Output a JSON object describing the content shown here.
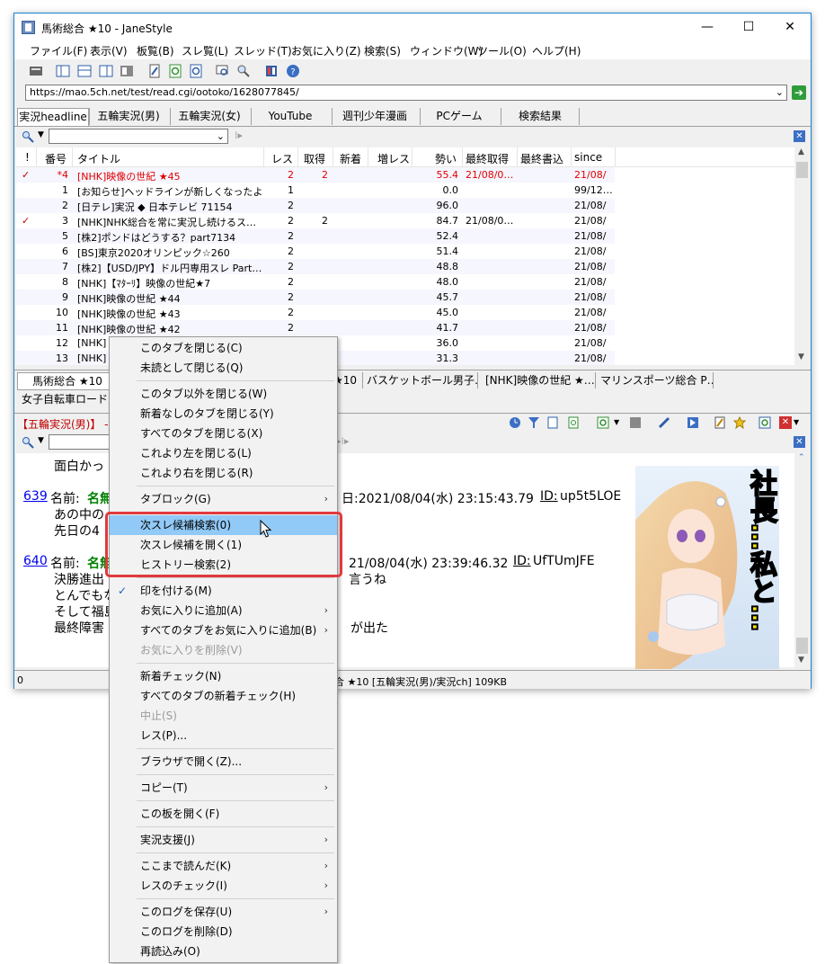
{
  "window": {
    "title": "馬術総合 ★10 - JaneStyle",
    "controls": {
      "minimize": "—",
      "maximize": "☐",
      "close": "✕"
    }
  },
  "menu": [
    "ファイル(F)",
    "表示(V)",
    "板覧(B)",
    "スレ覧(L)",
    "スレッド(T)",
    "お気に入り(Z)",
    "検索(S)",
    "ウィンドウ(W)",
    "ツール(O)",
    "ヘルプ(H)"
  ],
  "address": {
    "url": "https://mao.5ch.net/test/read.cgi/ootoko/1628077845/",
    "go": "➔"
  },
  "board_tabs": [
    "実況headline",
    "五輪実況(男)",
    "五輪実況(女)",
    "YouTube",
    "週刊少年漫画",
    "PCゲーム",
    "検索結果"
  ],
  "thread_list": {
    "columns": [
      "!",
      "番号",
      "タイトル",
      "レス",
      "取得",
      "新着",
      "増レス",
      "勢い",
      "最終取得",
      "最終書込",
      "since"
    ],
    "rows": [
      {
        "mark": "✓",
        "num": "*4",
        "title": "[NHK]映像の世紀 ★45",
        "res": "2",
        "got": "2",
        "ikioi": "55.4",
        "last_get": "21/08/0…",
        "since": "21/08/",
        "red": true
      },
      {
        "mark": "",
        "num": "1",
        "title": "[お知らせ]ヘッドラインが新しくなったよ",
        "res": "1",
        "got": "",
        "ikioi": "0.0",
        "last_get": "",
        "since": "99/12…",
        "red": false
      },
      {
        "mark": "",
        "num": "2",
        "title": "[日テレ]実況 ◆ 日本テレビ 71154",
        "res": "2",
        "got": "",
        "ikioi": "96.0",
        "last_get": "",
        "since": "21/08/",
        "red": false
      },
      {
        "mark": "✓",
        "num": "3",
        "title": "[NHK]NHK総合を常に実況し続けるス…",
        "res": "2",
        "got": "2",
        "ikioi": "84.7",
        "last_get": "21/08/0…",
        "since": "21/08/",
        "red": false
      },
      {
        "mark": "",
        "num": "5",
        "title": "[株2]ポンドはどうする？part7134",
        "res": "2",
        "got": "",
        "ikioi": "52.4",
        "last_get": "",
        "since": "21/08/",
        "red": false
      },
      {
        "mark": "",
        "num": "6",
        "title": "[BS]東京2020オリンピック☆260",
        "res": "2",
        "got": "",
        "ikioi": "51.4",
        "last_get": "",
        "since": "21/08/",
        "red": false
      },
      {
        "mark": "",
        "num": "7",
        "title": "[株2]【USD/JPY】ドル円専用スレ Part…",
        "res": "2",
        "got": "",
        "ikioi": "48.8",
        "last_get": "",
        "since": "21/08/",
        "red": false
      },
      {
        "mark": "",
        "num": "8",
        "title": "[NHK]【ﾏﾀｰﾘ】映像の世紀★7",
        "res": "2",
        "got": "",
        "ikioi": "48.0",
        "last_get": "",
        "since": "21/08/",
        "red": false
      },
      {
        "mark": "",
        "num": "9",
        "title": "[NHK]映像の世紀 ★44",
        "res": "2",
        "got": "",
        "ikioi": "45.7",
        "last_get": "",
        "since": "21/08/",
        "red": false
      },
      {
        "mark": "",
        "num": "10",
        "title": "[NHK]映像の世紀 ★43",
        "res": "2",
        "got": "",
        "ikioi": "45.0",
        "last_get": "",
        "since": "21/08/",
        "red": false
      },
      {
        "mark": "",
        "num": "11",
        "title": "[NHK]映像の世紀 ★42",
        "res": "2",
        "got": "",
        "ikioi": "41.7",
        "last_get": "",
        "since": "21/08/",
        "red": false
      },
      {
        "mark": "",
        "num": "12",
        "title": "[NHK]",
        "res": "",
        "got": "",
        "ikioi": "36.0",
        "last_get": "",
        "since": "21/08/",
        "red": false
      },
      {
        "mark": "",
        "num": "13",
        "title": "[NHK]",
        "res": "",
        "got": "",
        "ikioi": "31.3",
        "last_get": "",
        "since": "21/08/",
        "red": false
      }
    ]
  },
  "thread_tabs": [
    "馬術総合 ★10",
    "★10",
    "バスケットボール男子…",
    "[NHK]映像の世紀 ★…",
    "マリンスポーツ総合 P…"
  ],
  "thread_tabs_row2": "女子自転車ロードレ",
  "thread": {
    "header": "【五輪実況(男)】 -",
    "posts": [
      {
        "line1_tail": "面白かっ"
      },
      {
        "num": "639",
        "name": "名前:",
        "name_bold": "名無",
        "date": "日:2021/08/04(水) 23:15:43.79",
        "id_label": "ID:",
        "id": "up5t5LOE",
        "lines": [
          "あの中の",
          "先日の4"
        ]
      },
      {
        "num": "640",
        "name": "名前:",
        "name_bold": "名無",
        "date": "21/08/04(水) 23:39:46.32",
        "id_label": "ID:",
        "id": "UfTUmJFE",
        "lines": [
          "決勝進出",
          "とんでもな",
          "そして福島",
          "最終障害"
        ],
        "tails": [
          "言うね",
          "",
          "",
          "が出た"
        ]
      }
    ]
  },
  "status": {
    "left": "0",
    "right": "合 ★10  [五輪実況(男)/実況ch]  109KB"
  },
  "banner": {
    "text": "社長…私と…"
  },
  "context_menu": [
    {
      "label": "このタブを閉じる(C)"
    },
    {
      "label": "未読として閉じる(Q)"
    },
    {
      "sep": true
    },
    {
      "label": "このタブ以外を閉じる(W)"
    },
    {
      "label": "新着なしのタブを閉じる(Y)"
    },
    {
      "label": "すべてのタブを閉じる(X)"
    },
    {
      "label": "これより左を閉じる(L)"
    },
    {
      "label": "これより右を閉じる(R)"
    },
    {
      "sep": true
    },
    {
      "label": "タブロック(G)",
      "submenu": true
    },
    {
      "sep": true
    },
    {
      "label": "次スレ候補検索(0)",
      "hover": true
    },
    {
      "label": "次スレ候補を開く(1)"
    },
    {
      "label": "ヒストリー検索(2)"
    },
    {
      "sep": true
    },
    {
      "label": "印を付ける(M)",
      "checked": true
    },
    {
      "label": "お気に入りに追加(A)",
      "submenu": true
    },
    {
      "label": "すべてのタブをお気に入りに追加(B)",
      "submenu": true
    },
    {
      "label": "お気に入りを削除(V)",
      "disabled": true
    },
    {
      "sep": true
    },
    {
      "label": "新着チェック(N)"
    },
    {
      "label": "すべてのタブの新着チェック(H)"
    },
    {
      "label": "中止(S)",
      "disabled": true
    },
    {
      "label": "レス(P)..."
    },
    {
      "sep": true
    },
    {
      "label": "ブラウザで開く(Z)..."
    },
    {
      "sep": true
    },
    {
      "label": "コピー(T)",
      "submenu": true
    },
    {
      "sep": true
    },
    {
      "label": "この板を開く(F)"
    },
    {
      "sep": true
    },
    {
      "label": "実況支援(J)",
      "submenu": true
    },
    {
      "sep": true
    },
    {
      "label": "ここまで読んだ(K)",
      "submenu": true
    },
    {
      "label": "レスのチェック(I)",
      "submenu": true
    },
    {
      "sep": true
    },
    {
      "label": "このログを保存(U)",
      "submenu": true
    },
    {
      "label": "このログを削除(D)"
    },
    {
      "label": "再読込み(O)"
    }
  ],
  "colors": {
    "accent": "#1883d7",
    "highlight_box": "#e0393e",
    "menu_hover": "#91c9f7",
    "red_text": "#e00000",
    "link_blue": "#0000ee",
    "name_green": "#008000"
  }
}
